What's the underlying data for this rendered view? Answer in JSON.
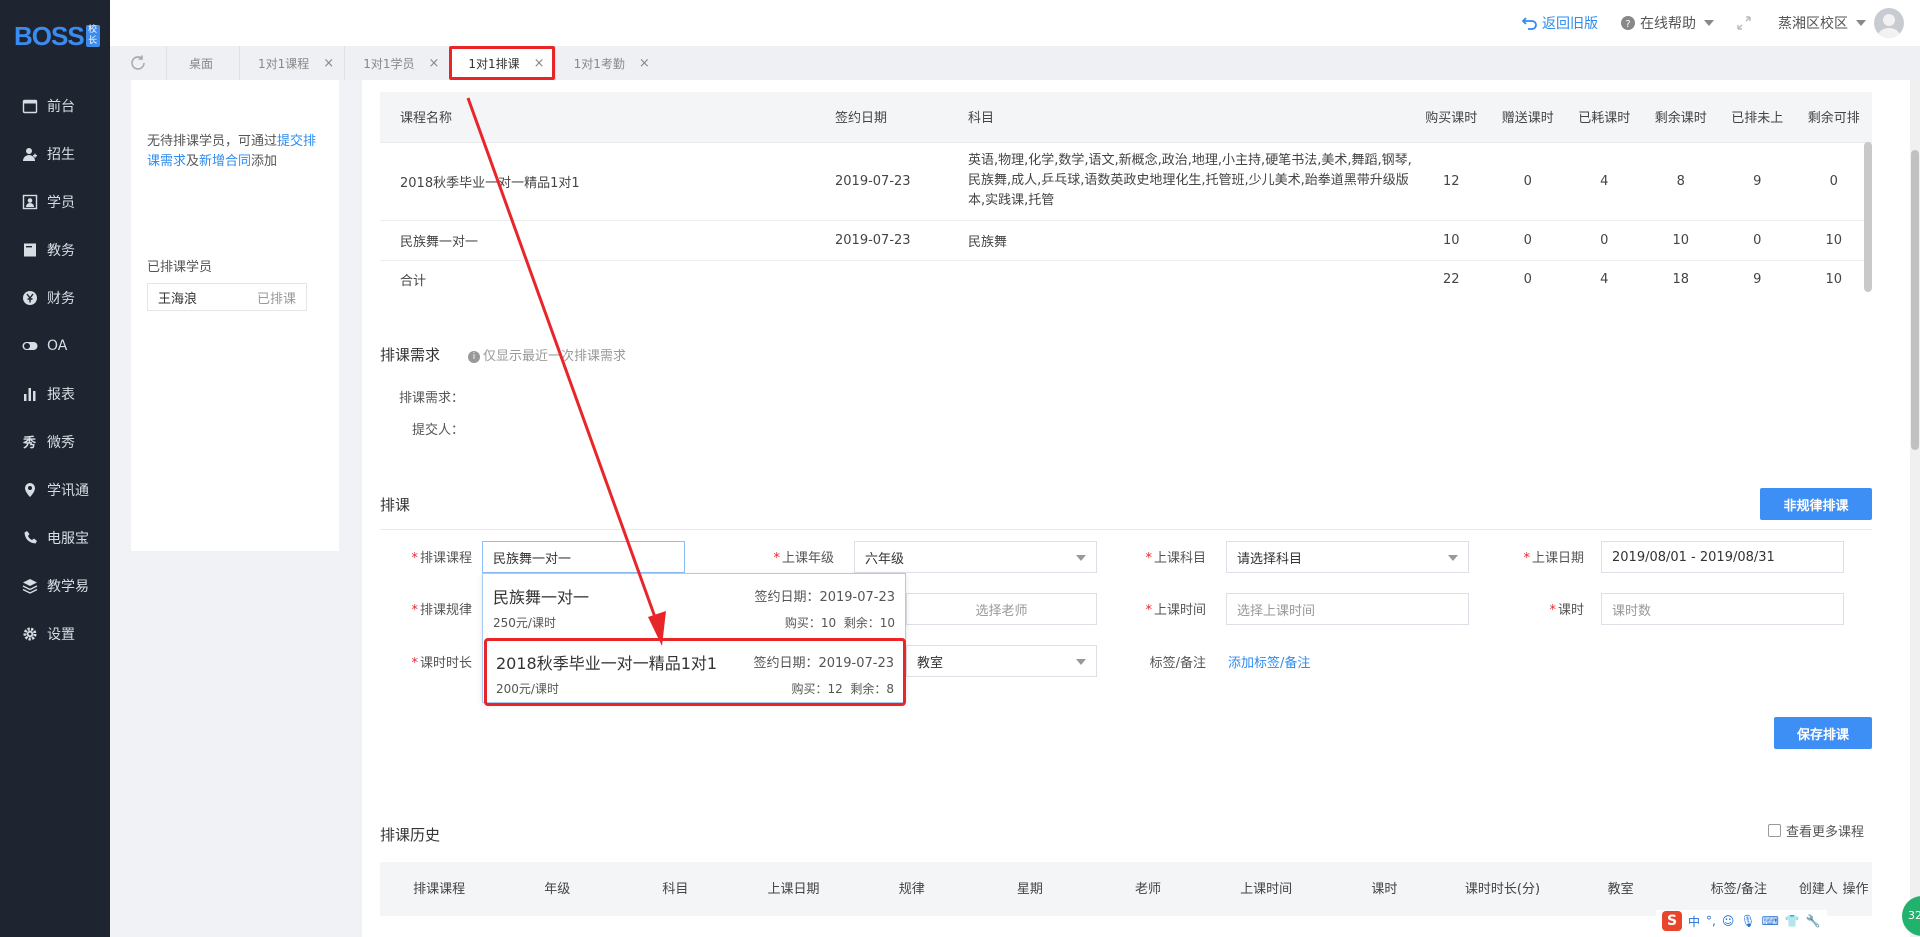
{
  "brand": {
    "name": "BOSS",
    "badge": "校长"
  },
  "sidebar": {
    "items": [
      {
        "id": "desk",
        "label": "前台",
        "icon": "calendar-icon"
      },
      {
        "id": "enroll",
        "label": "招生",
        "icon": "user-add-icon"
      },
      {
        "id": "student",
        "label": "学员",
        "icon": "id-card-icon"
      },
      {
        "id": "teaching",
        "label": "教务",
        "icon": "book-icon"
      },
      {
        "id": "finance",
        "label": "财务",
        "icon": "yen-coin-icon"
      },
      {
        "id": "oa",
        "label": "OA",
        "icon": "toggle-icon"
      },
      {
        "id": "report",
        "label": "报表",
        "icon": "bar-chart-icon"
      },
      {
        "id": "weixiu",
        "label": "微秀",
        "icon": "xiu-icon"
      },
      {
        "id": "xuexuntong",
        "label": "学讯通",
        "icon": "location-pin-icon"
      },
      {
        "id": "dianfubao",
        "label": "电服宝",
        "icon": "phone-icon"
      },
      {
        "id": "jiaoxueyi",
        "label": "教学易",
        "icon": "layers-icon"
      },
      {
        "id": "settings",
        "label": "设置",
        "icon": "gear-icon"
      }
    ]
  },
  "topbar": {
    "back_old": "返回旧版",
    "help": "在线帮助",
    "campus": "蒸湘区校区"
  },
  "tabs": [
    {
      "label": "桌面",
      "closable": false
    },
    {
      "label": "1对1课程",
      "closable": true
    },
    {
      "label": "1对1学员",
      "closable": true
    },
    {
      "label": "1对1排课",
      "closable": true,
      "active": true
    },
    {
      "label": "1对1考勤",
      "closable": true
    }
  ],
  "left_panel": {
    "note_prefix": "无待排课学员，可通过",
    "note_link1": "提交排课需求",
    "note_mid": "及",
    "note_link2": "新增合同",
    "note_suffix": "添加",
    "scheduled_title": "已排课学员",
    "students": [
      {
        "name": "王海浪",
        "status": "已排课"
      }
    ]
  },
  "summary_table": {
    "columns": [
      "课程名称",
      "签约日期",
      "科目",
      "购买课时",
      "赠送课时",
      "已耗课时",
      "剩余课时",
      "已排未上",
      "剩余可排"
    ],
    "rows": [
      {
        "name": "2018秋季毕业一对一精品1对1",
        "date": "2019-07-23",
        "subjects": "英语,物理,化学,数学,语文,新概念,政治,地理,小主持,硬笔书法,美术,舞蹈,钢琴,民族舞,成人,乒乓球,语数英政史地理化生,托管班,少儿美术,跆拳道黑带升级版本,实践课,托管",
        "buy": "12",
        "gift": "0",
        "used": "4",
        "remain": "8",
        "scheduled": "9",
        "can": "0"
      },
      {
        "name": "民族舞一对一",
        "date": "2019-07-23",
        "subjects": "民族舞",
        "buy": "10",
        "gift": "0",
        "used": "0",
        "remain": "10",
        "scheduled": "0",
        "can": "10"
      },
      {
        "name": "合计",
        "date": "",
        "subjects": "",
        "buy": "22",
        "gift": "0",
        "used": "4",
        "remain": "18",
        "scheduled": "9",
        "can": "10"
      }
    ]
  },
  "demand": {
    "title": "排课需求",
    "hint": "仅显示最近一次排课需求",
    "demand_label": "排课需求：",
    "submitter_label": "提交人："
  },
  "schedule": {
    "title": "排课",
    "irregular_button": "非规律排课",
    "course_label": "排课课程",
    "course_value": "民族舞一对一",
    "grade_label": "上课年级",
    "grade_value": "六年级",
    "subject_label": "上课科目",
    "subject_placeholder": "请选择科目",
    "date_label": "上课日期",
    "date_value": "2019/08/01 - 2019/08/31",
    "rule_label": "排课规律",
    "teacher_placeholder": "选择老师",
    "time_label": "上课时间",
    "time_placeholder": "选择上课时间",
    "hours_label": "课时",
    "hours_placeholder": "课时数",
    "duration_label": "课时时长",
    "room_value": "教室",
    "tag_label": "标签/备注",
    "tag_link": "添加标签/备注",
    "save_button": "保存排课"
  },
  "course_dropdown": [
    {
      "name": "民族舞一对一",
      "date": "签约日期：2019-07-23",
      "price": "250元/课时",
      "counts": "购买：10  剩余：10"
    },
    {
      "name": "2018秋季毕业一对一精品1对1",
      "date": "签约日期：2019-07-23",
      "price": "200元/课时",
      "counts": "购买：12  剩余：8"
    }
  ],
  "history": {
    "title": "排课历史",
    "more_label": "查看更多课程",
    "columns": [
      "排课课程",
      "年级",
      "科目",
      "上课日期",
      "规律",
      "星期",
      "老师",
      "上课时间",
      "课时",
      "课时时长(分)",
      "教室",
      "标签/备注",
      "创建人",
      "操作"
    ]
  },
  "tray": {
    "s": "S",
    "ime": "中",
    "ball": "32"
  },
  "colors": {
    "sidebar_bg": "#1f2530",
    "accent": "#3d8ff5",
    "annotation_red": "#e8262a"
  }
}
